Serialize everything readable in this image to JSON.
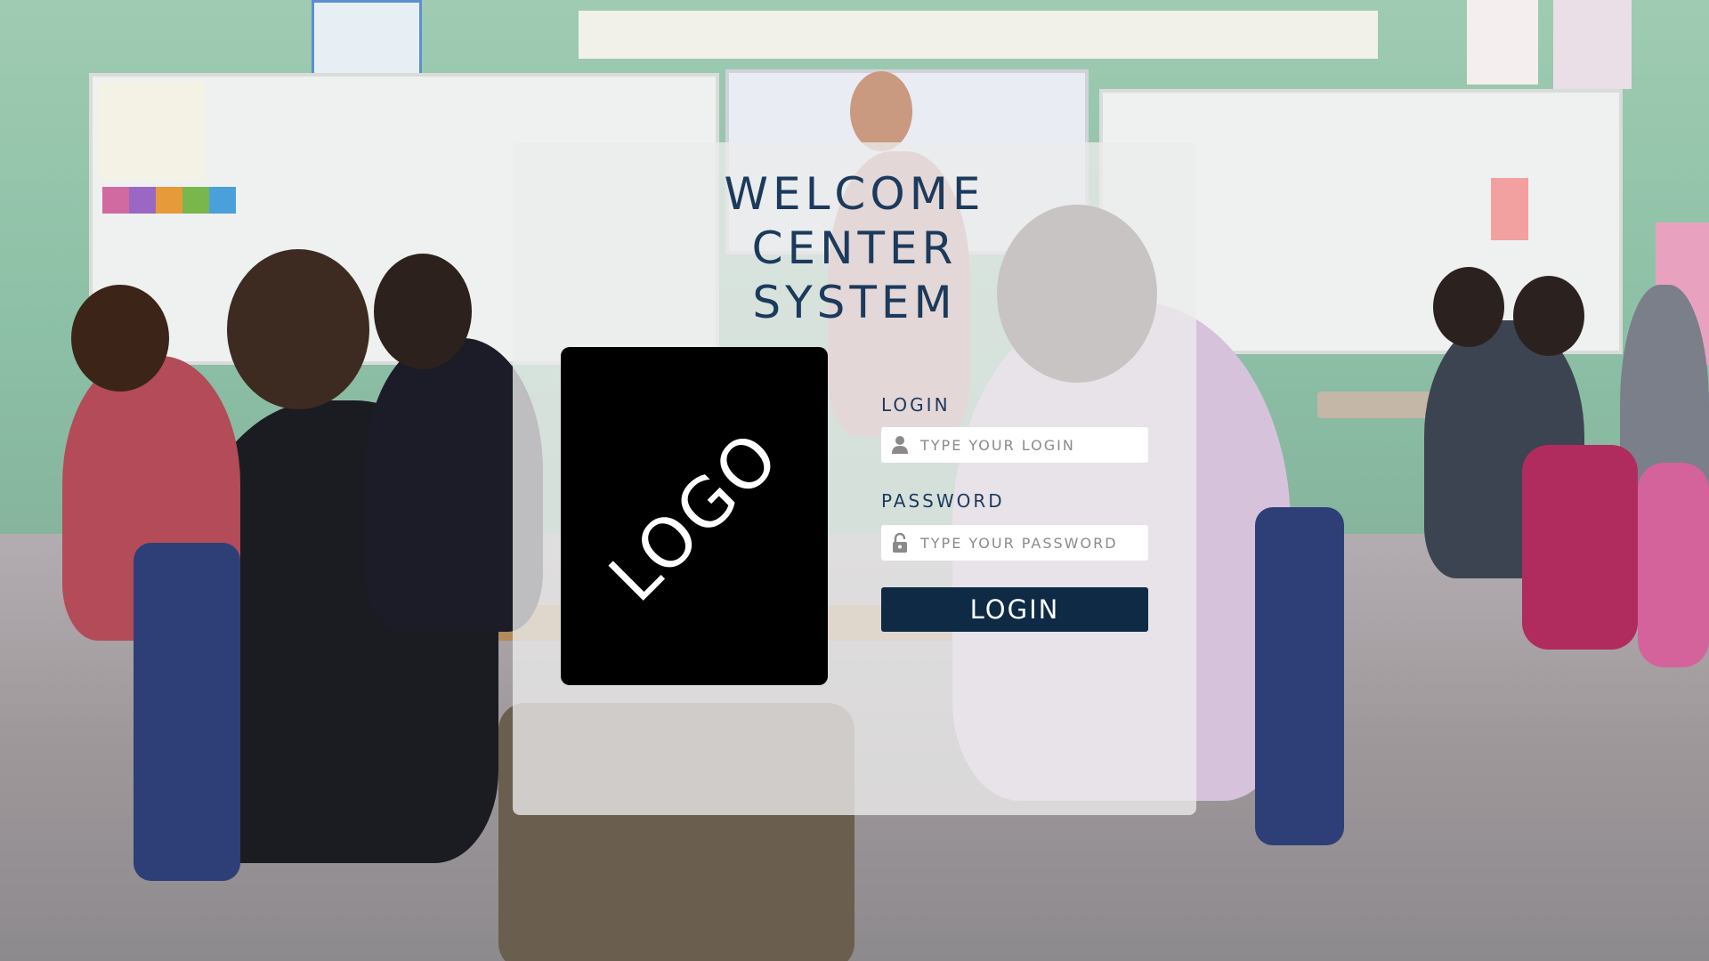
{
  "title_lines": [
    "WELCOME",
    "CENTER",
    "SYSTEM"
  ],
  "logo": {
    "text": "LOGO"
  },
  "login_field": {
    "label": "LOGIN",
    "placeholder": "TYPE YOUR LOGIN",
    "value": "",
    "icon": "user-icon"
  },
  "password_field": {
    "label": "PASSWORD",
    "placeholder": "TYPE YOUR PASSWORD",
    "value": "",
    "icon": "lock-icon"
  },
  "submit": {
    "label": "LOGIN"
  },
  "colors": {
    "title": "#1b3a5c",
    "button": "#0e2a45",
    "panel": "rgba(236,236,236,0.78)",
    "logo_bg": "#000000"
  }
}
